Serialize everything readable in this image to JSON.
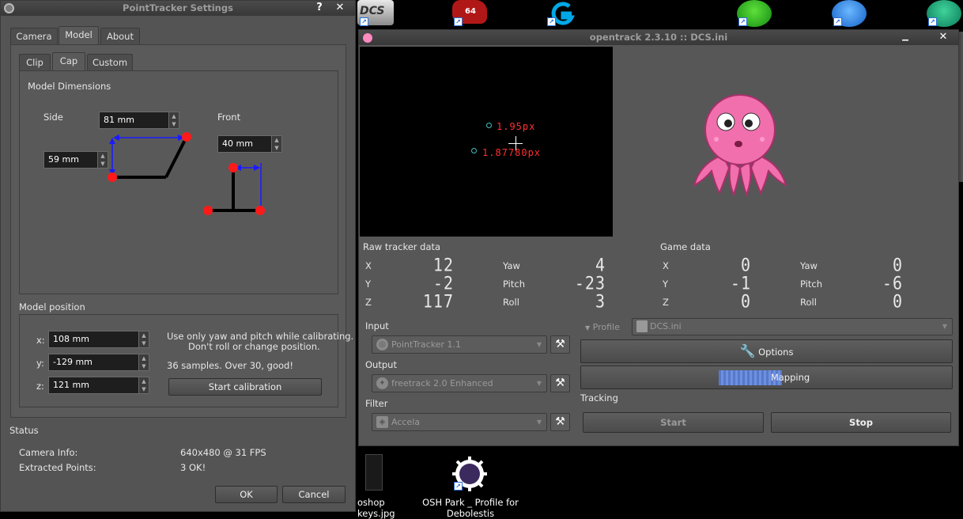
{
  "desktop": {
    "top_icons": [
      "dcs-icon",
      "64-icon",
      "logitech-g-icon",
      "green-f-icon",
      "blue-c-icon",
      "green-u-icon"
    ],
    "top_badge": "64",
    "dcs_label": "DCS",
    "bottom_items": [
      {
        "label": "oshop keys.jpg"
      },
      {
        "label": "OSH Park _ Profile for Debolestis"
      }
    ]
  },
  "pt": {
    "title": "PointTracker Settings",
    "help": "?",
    "close": "✕",
    "tabs": [
      "Camera",
      "Model",
      "About"
    ],
    "subtabs": [
      "Clip",
      "Cap",
      "Custom"
    ],
    "model_dimensions": "Model Dimensions",
    "side": "Side",
    "front": "Front",
    "side_top": "81 mm",
    "side_left": "59 mm",
    "front_val": "40 mm",
    "model_position": "Model position",
    "x_label": "x:",
    "y_label": "y:",
    "z_label": "z:",
    "x_val": "108 mm",
    "y_val": "-129 mm",
    "z_val": "121 mm",
    "calib_note_1": "Use only yaw and pitch while calibrating.",
    "calib_note_2": "Don't roll or change position.",
    "samples": "36 samples. Over 30, good!",
    "start_calibration": "Start calibration",
    "status": "Status",
    "camera_info_label": "Camera Info:",
    "camera_info": "640x480 @ 31 FPS",
    "extracted_label": "Extracted Points:",
    "extracted": "3 OK!",
    "ok": "OK",
    "cancel": "Cancel"
  },
  "ot": {
    "title": "opentrack 2.3.10 :: DCS.ini",
    "minimize": "▁",
    "close": "✕",
    "preview_text_1": "1.95px",
    "preview_text_2": "1.87780px",
    "raw_tracker": "Raw tracker data",
    "game_data": "Game data",
    "raw": {
      "x": "12",
      "y": "-2",
      "z": "117",
      "yaw": "4",
      "pitch": "-23",
      "roll": "3"
    },
    "game": {
      "x": "0",
      "y": "-1",
      "z": "0",
      "yaw": "0",
      "pitch": "-6",
      "roll": "0"
    },
    "labels": {
      "x": "X",
      "y": "Y",
      "z": "Z",
      "yaw": "Yaw",
      "pitch": "Pitch",
      "roll": "Roll"
    },
    "input": "Input",
    "input_val": "PointTracker 1.1",
    "output": "Output",
    "output_val": "freetrack 2.0 Enhanced",
    "filter": "Filter",
    "filter_val": "Accela",
    "profile": "Profile",
    "profile_val": "DCS.ini",
    "options": "Options",
    "mapping": "Mapping",
    "tracking": "Tracking",
    "start": "Start",
    "stop": "Stop"
  }
}
